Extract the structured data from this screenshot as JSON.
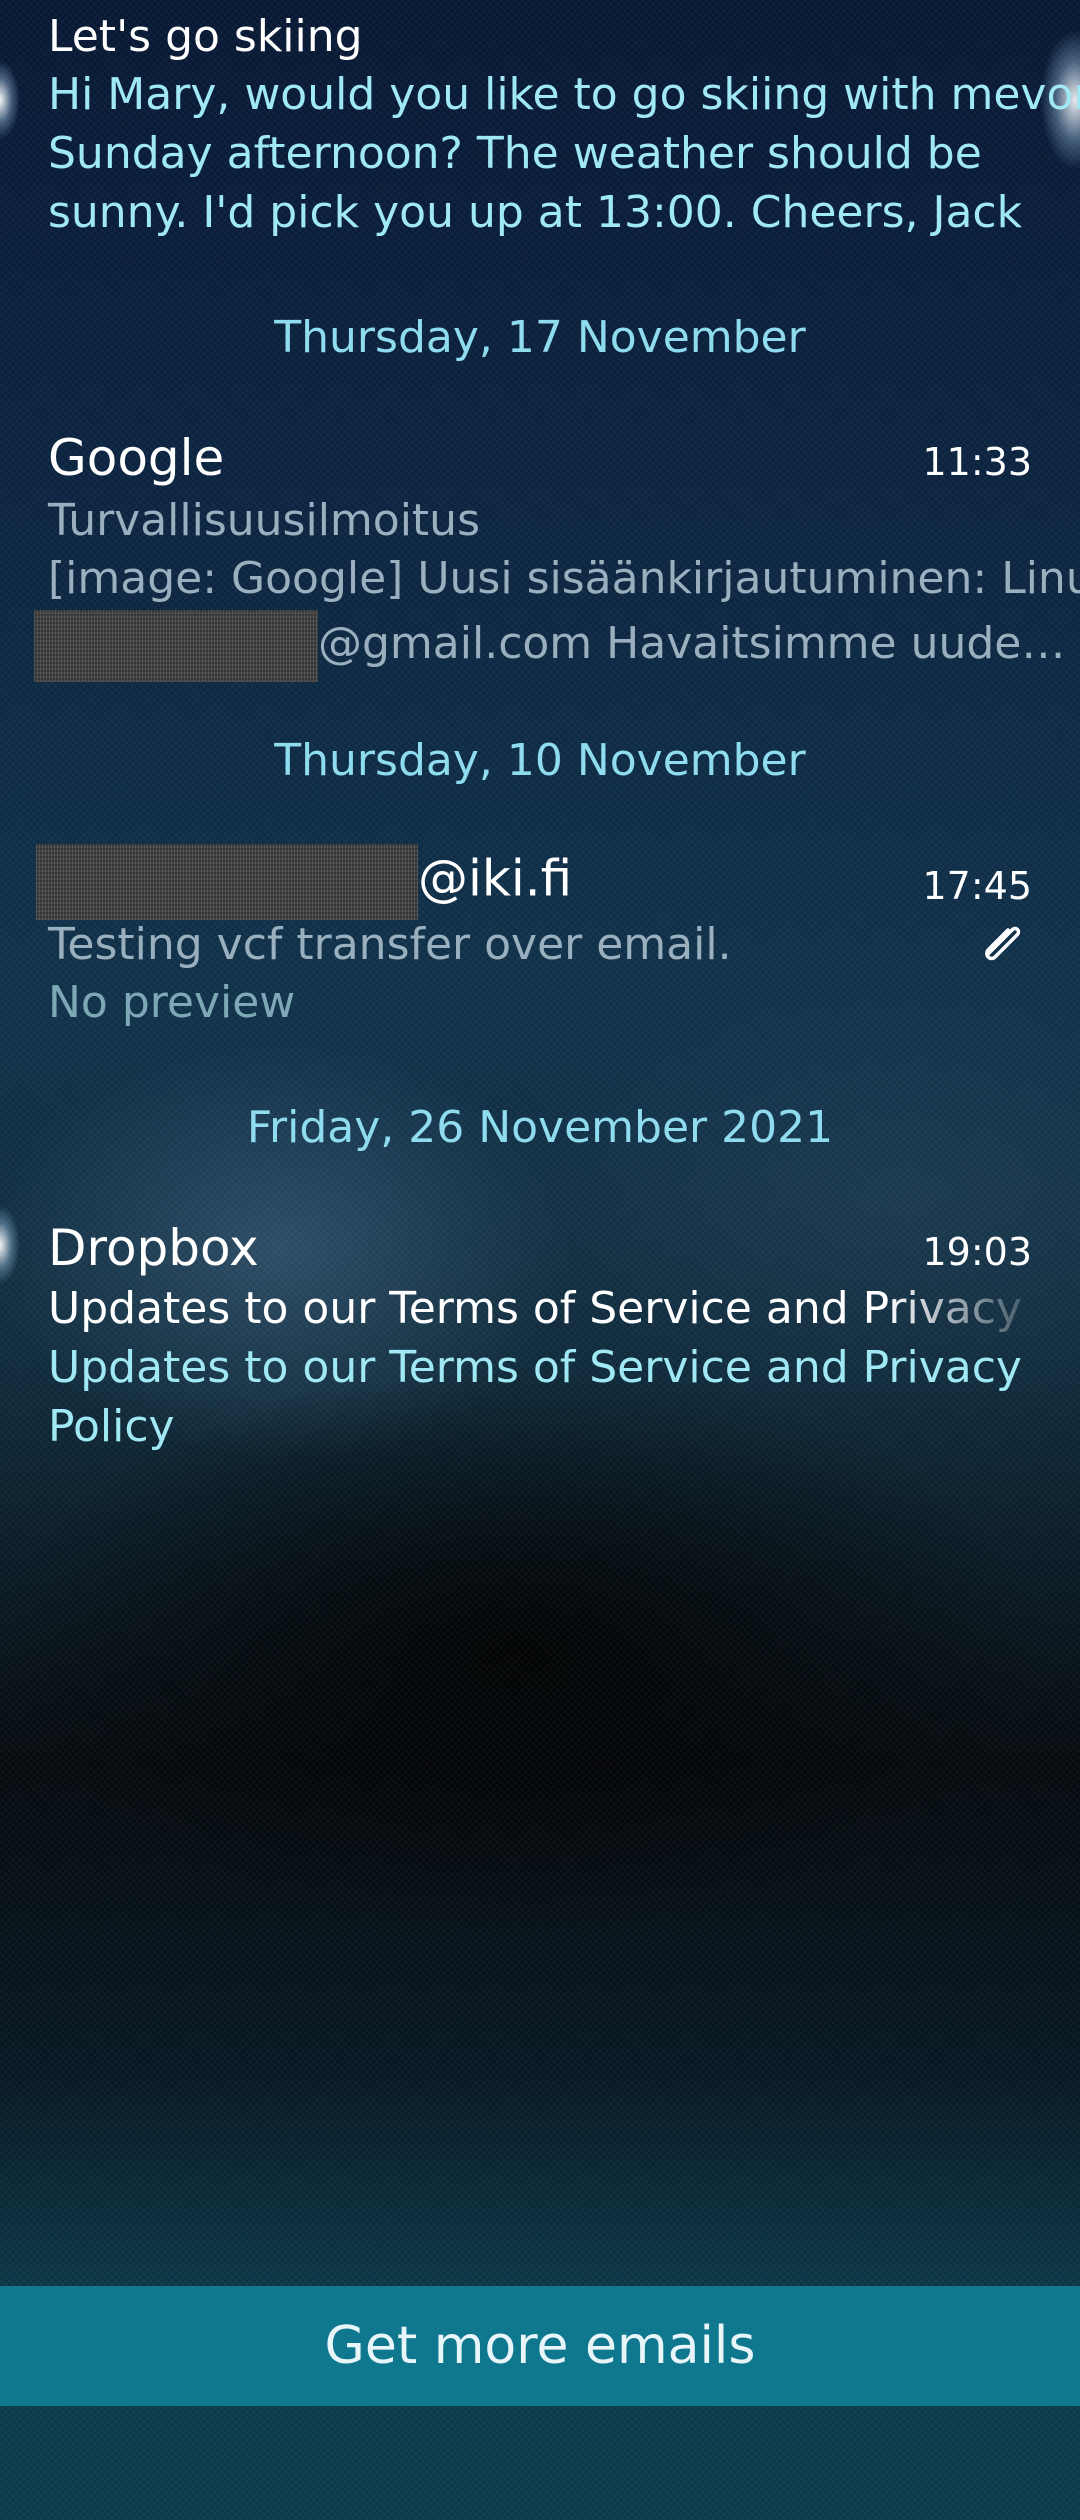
{
  "items": [
    {
      "subject": "Let's go skiing",
      "preview": [
        "Hi Mary, would you like to go skiing with mevon",
        "Sunday afternoon? The weather should be",
        "sunny. I'd pick you up at 13:00. Cheers, Jack"
      ]
    },
    {
      "date_header": "Thursday, 17 November",
      "sender": "Google",
      "time": "11:33",
      "subject": "Turvallisuusilmoitus",
      "preview": [
        "[image: Google] Uusi sisäänkirjautuminen: Linux",
        "@gmail.com Havaitsimme uude…"
      ]
    },
    {
      "date_header": "Thursday, 10 November",
      "sender": "@iki.fi",
      "time": "17:45",
      "subject": "Testing vcf transfer over email.",
      "preview": "No preview",
      "attachment_icon": "paperclip-icon"
    },
    {
      "date_header": "Friday, 26 November 2021",
      "sender": "Dropbox",
      "time": "19:03",
      "subject": "Updates to our Terms of Service and Privacy Pol",
      "preview": [
        "Updates to our Terms of Service and Privacy",
        "Policy"
      ]
    }
  ],
  "footer": {
    "get_more_label": "Get more emails"
  },
  "colors": {
    "accent": "#9fe8f4",
    "button": "#0f788f"
  }
}
